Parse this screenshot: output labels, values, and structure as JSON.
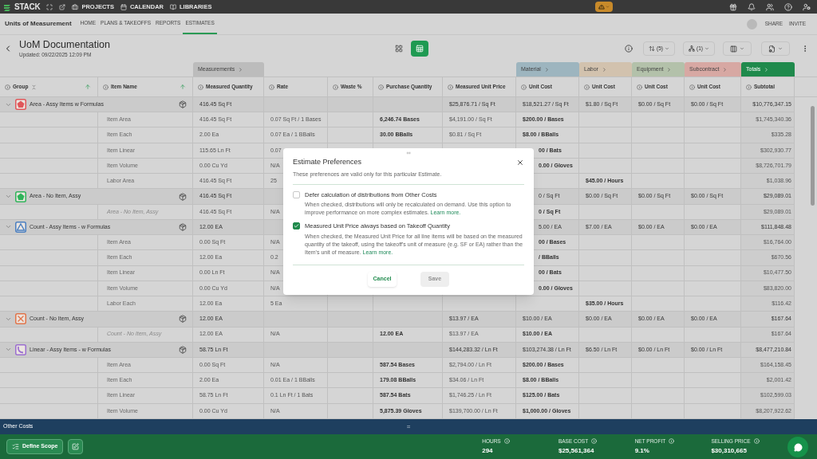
{
  "top_bar": {
    "logo": "STACK",
    "nav": [
      "PROJECTS",
      "CALENDAR",
      "LIBRARIES"
    ]
  },
  "nav_bar": {
    "project": "Units of Measurement",
    "tabs": [
      {
        "label": "HOME",
        "selected": false
      },
      {
        "label": "PLANS & TAKEOFFS",
        "selected": false
      },
      {
        "label": "REPORTS",
        "selected": false
      },
      {
        "label": "ESTIMATES",
        "selected": true
      }
    ],
    "actions": [
      "SHARE",
      "INVITE"
    ]
  },
  "header": {
    "title": "UoM Documentation",
    "updated": "Updated: 09/22/2025 12:09 PM",
    "view_toggle": [
      {
        "kind": "cards",
        "selected": false
      },
      {
        "kind": "table",
        "selected": true
      }
    ],
    "sort_count": "(5)",
    "group_count": "(1)"
  },
  "column_groups": [
    {
      "columns": [
        {
          "label": "Group",
          "sorted": true
        },
        {
          "label": "Item Name",
          "sorted": true
        }
      ]
    },
    {
      "label": "Measurements",
      "color": "#bcbcbc",
      "columns": [
        {
          "label": "Measured Quantity",
          "sorted": false
        }
      ]
    },
    {
      "columns": [
        {
          "label": "Rate",
          "sorted": false
        },
        {
          "label": "Waste %",
          "sorted": false
        },
        {
          "label": "Purchase Quantity",
          "sorted": false
        },
        {
          "label": "Measured Unit Price",
          "sorted": false
        }
      ]
    },
    {
      "label": "Material",
      "color": "#9db5bf",
      "columns": [
        {
          "label": "Unit Cost",
          "sorted": false
        }
      ]
    },
    {
      "label": "Labor",
      "color": "#d2c2ae",
      "columns": [
        {
          "label": "Unit Cost",
          "sorted": false
        }
      ]
    },
    {
      "label": "Equipment",
      "color": "#b3c1aa",
      "columns": [
        {
          "label": "Unit Cost",
          "sorted": false
        }
      ]
    },
    {
      "label": "Subcontract",
      "color": "#d7a8a3",
      "columns": [
        {
          "label": "Unit Cost",
          "sorted": false
        }
      ]
    },
    {
      "label": "Totals",
      "color": "#1f8a4c",
      "columns": [
        {
          "label": "Subtotal",
          "sorted": false
        }
      ]
    }
  ],
  "rows": [
    {
      "kind": "group",
      "expanded": true,
      "marker": {
        "kind": "pentagon",
        "color": "#e0575a"
      },
      "cells": [
        "Area - Assy Items w Formulas",
        null,
        "416.45 Sq Ft",
        null,
        null,
        null,
        "$25,876.71 / Sq Ft",
        "$18,521.27 / Sq Ft",
        "$1.80 / Sq Ft",
        "$0.00 / Sq Ft",
        "$0.00 / Sq Ft",
        "$10,776,347.15"
      ]
    },
    {
      "kind": "item",
      "cells": [
        null,
        "Item Area",
        "416.45 Sq Ft",
        "0.07 Sq Ft / 1 Bases",
        null,
        "6,246.74 Bases",
        "$4,191.00 / Sq Ft",
        "$200.00 / Bases",
        null,
        null,
        null,
        "$1,745,340.36"
      ]
    },
    {
      "kind": "item",
      "cells": [
        null,
        "Item Each",
        "2.00 Ea",
        "0.07 Ea / 1 BBalls",
        null,
        "30.00 BBalls",
        "$0.81 / Sq Ft",
        "$8.00 / BBalls",
        null,
        null,
        null,
        "$335.28"
      ]
    },
    {
      "kind": "item",
      "cells": [
        null,
        "Item Linear",
        "115.65 Ln Ft",
        "0.07",
        null,
        null,
        null,
        {
          "text": "00 / Bats",
          "kind": "cut"
        },
        null,
        null,
        null,
        "$302,930.77"
      ]
    },
    {
      "kind": "item",
      "cells": [
        null,
        "Item Volume",
        "0.00 Cu Yd",
        "N/A",
        null,
        null,
        null,
        {
          "text": "0.00 / Gloves",
          "kind": "cut"
        },
        null,
        null,
        null,
        "$8,726,701.79"
      ]
    },
    {
      "kind": "item",
      "cells": [
        null,
        "Labor Area",
        "416.45 Sq Ft",
        "25",
        null,
        null,
        null,
        null,
        "$45.00 / Hours",
        null,
        null,
        "$1,038.96"
      ]
    },
    {
      "kind": "group",
      "expanded": true,
      "marker": {
        "kind": "pentagon",
        "color": "#2fb35a"
      },
      "cells": [
        "Area - No Item, Assy",
        null,
        "416.45 Sq Ft",
        null,
        null,
        null,
        null,
        {
          "text": "0 / Sq Ft",
          "kind": "cut"
        },
        "$0.00 / Sq Ft",
        "$0.00 / Sq Ft",
        "$0.00 / Sq Ft",
        "$29,089.01"
      ]
    },
    {
      "kind": "note",
      "cells": [
        null,
        "Area - No Item, Assy",
        "416.45 Sq Ft",
        "N/A",
        null,
        null,
        null,
        {
          "text": "0 / Sq Ft",
          "kind": "cut"
        },
        null,
        null,
        null,
        "$29,089.01"
      ]
    },
    {
      "kind": "group",
      "expanded": true,
      "marker": {
        "kind": "triangle",
        "color": "#4a7fc0"
      },
      "cells": [
        "Count - Assy Items - w Formulas",
        null,
        "12.00 EA",
        null,
        null,
        null,
        null,
        {
          "text": "5.00 / EA",
          "kind": "cut"
        },
        "$7.00 / EA",
        "$0.00 / EA",
        "$0.00 / EA",
        "$111,848.48"
      ]
    },
    {
      "kind": "item",
      "cells": [
        null,
        "Item Area",
        "0.00 Sq Ft",
        "N/A",
        null,
        null,
        null,
        {
          "text": "00 / Bases",
          "kind": "cut"
        },
        null,
        null,
        null,
        "$16,764.00"
      ]
    },
    {
      "kind": "item",
      "cells": [
        null,
        "Item Each",
        "12.00 Ea",
        "0.2",
        null,
        null,
        null,
        {
          "text": "/ BBalls",
          "kind": "cut"
        },
        null,
        null,
        null,
        "$670.56"
      ]
    },
    {
      "kind": "item",
      "cells": [
        null,
        "Item Linear",
        "0.00 Ln Ft",
        "N/A",
        null,
        null,
        null,
        {
          "text": "00 / Bats",
          "kind": "cut"
        },
        null,
        null,
        null,
        "$10,477.50"
      ]
    },
    {
      "kind": "item",
      "cells": [
        null,
        "Item Volume",
        "0.00 Cu Yd",
        "N/A",
        null,
        null,
        null,
        {
          "text": "0.00 / Gloves",
          "kind": "cut"
        },
        null,
        null,
        null,
        "$83,820.00"
      ]
    },
    {
      "kind": "item",
      "cells": [
        null,
        "Labor Each",
        "12.00 Ea",
        "5 Ea",
        null,
        null,
        null,
        null,
        "$35.00 / Hours",
        null,
        null,
        "$116.42"
      ]
    },
    {
      "kind": "group",
      "expanded": true,
      "marker": {
        "kind": "cross",
        "color": "#e0744a"
      },
      "cells": [
        "Count - No Item, Assy",
        null,
        "12.00 EA",
        null,
        null,
        null,
        "$13.97 / EA",
        "$10.00 / EA",
        "$0.00 / EA",
        "$0.00 / EA",
        "$0.00 / EA",
        "$167.64"
      ]
    },
    {
      "kind": "note",
      "cells": [
        null,
        "Count - No Item, Assy",
        "12.00 EA",
        "N/A",
        null,
        "12.00 EA",
        "$13.97 / EA",
        "$10.00 / EA",
        null,
        null,
        null,
        "$167.64"
      ]
    },
    {
      "kind": "group",
      "expanded": true,
      "marker": {
        "kind": "curve",
        "color": "#9b6fd0"
      },
      "cells": [
        "Linear - Assy Items - w Formulas",
        null,
        "58.75 Ln Ft",
        null,
        null,
        null,
        "$144,283.32 / Ln Ft",
        "$103,274.38 / Ln Ft",
        "$6.50 / Ln Ft",
        "$0.00 / Ln Ft",
        "$0.00 / Ln Ft",
        "$8,477,210.84"
      ]
    },
    {
      "kind": "item",
      "cells": [
        null,
        "Item Area",
        "0.00 Sq Ft",
        "N/A",
        null,
        "587.54 Bases",
        "$2,794.00 / Ln Ft",
        "$200.00 / Bases",
        null,
        null,
        null,
        "$164,158.45"
      ]
    },
    {
      "kind": "item",
      "cells": [
        null,
        "Item Each",
        "2.00 Ea",
        "0.01 Ea / 1 BBalls",
        null,
        "179.08 BBalls",
        "$34.06 / Ln Ft",
        "$8.00 / BBalls",
        null,
        null,
        null,
        "$2,001.42"
      ]
    },
    {
      "kind": "item",
      "cells": [
        null,
        "Item Linear",
        "58.75 Ln Ft",
        "0.1 Ln Ft / 1 Bats",
        null,
        "587.54 Bats",
        "$1,746.25 / Ln Ft",
        "$125.00 / Bats",
        null,
        null,
        null,
        "$102,599.03"
      ]
    },
    {
      "kind": "item",
      "cells": [
        null,
        "Item Volume",
        "0.00 Cu Yd",
        "N/A",
        null,
        "5,875.39 Gloves",
        "$139,700.00 / Ln Ft",
        "$1,000.00 / Gloves",
        null,
        null,
        null,
        "$8,207,922.62"
      ]
    }
  ],
  "other_costs": {
    "label": "Other Costs",
    "handle": "="
  },
  "footer": {
    "button": "Define Scope",
    "stats": [
      {
        "label": "HOURS",
        "value": "294"
      },
      {
        "label": "BASE COST",
        "value": "$25,561,364"
      },
      {
        "label": "NET PROFIT",
        "value": "9.1%"
      },
      {
        "label": "SELLING PRICE",
        "value": "$30,310,665"
      }
    ]
  },
  "dialog": {
    "title": "Estimate Preferences",
    "subtitle": "These preferences are valid only for this particular Estimate.",
    "options": [
      {
        "label": "Defer calculation of distributions from Other Costs",
        "description": "When checked, distributions will only be recalculated on demand. Use this option to improve performance on more complex estimates.",
        "link": "Learn more.",
        "checked": false
      },
      {
        "label": "Measured Unit Price always based on Takeoff Quantity",
        "description": "When checked, the Measured Unit Price for all line items will be based on the measured quantity of the takeoff, using the takeoff's unit of measure (e.g. SF or EA) rather than the Item's unit of measure.",
        "link": "Learn more.",
        "checked": true
      }
    ],
    "buttons": [
      {
        "label": "Cancel",
        "disabled": false
      },
      {
        "label": "Save",
        "disabled": true
      }
    ]
  }
}
